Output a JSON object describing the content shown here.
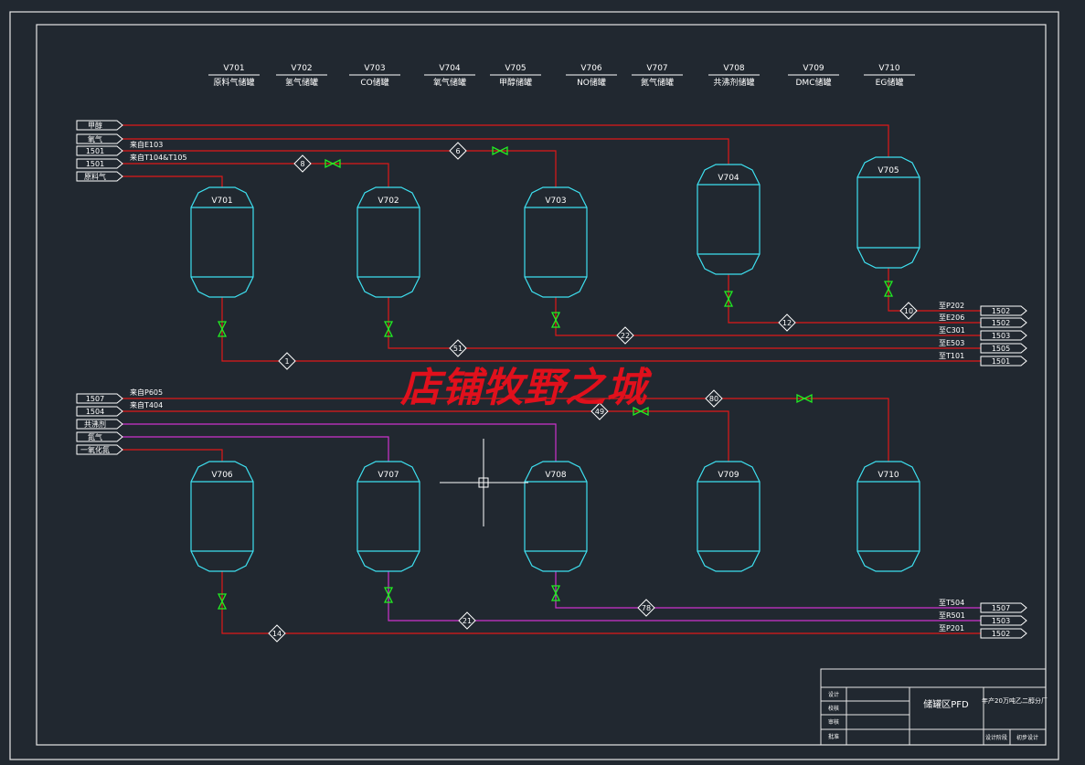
{
  "colors": {
    "background": "#212830",
    "border": "#e6e6e6",
    "vessel": "#3ee0f0",
    "pipe_red": "#e01818",
    "pipe_magenta": "#cc33cc",
    "valve": "#22ee22",
    "text": "#ffffff",
    "watermark": "#e0101c"
  },
  "header_labels": [
    {
      "tag": "V701",
      "name": "原料气储罐"
    },
    {
      "tag": "V702",
      "name": "氢气储罐"
    },
    {
      "tag": "V703",
      "name": "CO储罐"
    },
    {
      "tag": "V704",
      "name": "氧气储罐"
    },
    {
      "tag": "V705",
      "name": "甲醇储罐"
    },
    {
      "tag": "V706",
      "name": "NO储罐"
    },
    {
      "tag": "V707",
      "name": "氮气储罐"
    },
    {
      "tag": "V708",
      "name": "共沸剂储罐"
    },
    {
      "tag": "V709",
      "name": "DMC储罐"
    },
    {
      "tag": "V710",
      "name": "EG储罐"
    }
  ],
  "vessels": [
    "V701",
    "V702",
    "V703",
    "V704",
    "V705",
    "V706",
    "V707",
    "V708",
    "V709",
    "V710"
  ],
  "inlet_tags_top": [
    "甲醇",
    "氧气",
    "1501",
    "1501",
    "原料气"
  ],
  "inlet_notes_top": [
    "来自E103",
    "来自T104&T105"
  ],
  "inlet_tags_bottom": [
    "1507",
    "1504",
    "共沸剂",
    "氮气",
    "一氧化氮"
  ],
  "inlet_notes_bottom": [
    "来自P605",
    "来自T404"
  ],
  "stream_numbers": [
    "8",
    "6",
    "1",
    "51",
    "22",
    "12",
    "10",
    "80",
    "49",
    "78",
    "21",
    "14"
  ],
  "outlets_top": [
    {
      "dest": "至P202",
      "tag": "1502"
    },
    {
      "dest": "至E206",
      "tag": "1502"
    },
    {
      "dest": "至C301",
      "tag": "1503"
    },
    {
      "dest": "至E503",
      "tag": "1505"
    },
    {
      "dest": "至T101",
      "tag": "1501"
    }
  ],
  "outlets_bottom": [
    {
      "dest": "至T504",
      "tag": "1507"
    },
    {
      "dest": "至R501",
      "tag": "1503"
    },
    {
      "dest": "至P201",
      "tag": "1502"
    }
  ],
  "watermark": "店铺牧野之城",
  "title_block": {
    "drawing_title": "储罐区PFD",
    "project": "年产20万吨乙二醇分厂",
    "row_labels": [
      "设计",
      "校核",
      "审核",
      "批准"
    ],
    "bottom_cells": [
      "设计阶段",
      "初步设计"
    ]
  }
}
